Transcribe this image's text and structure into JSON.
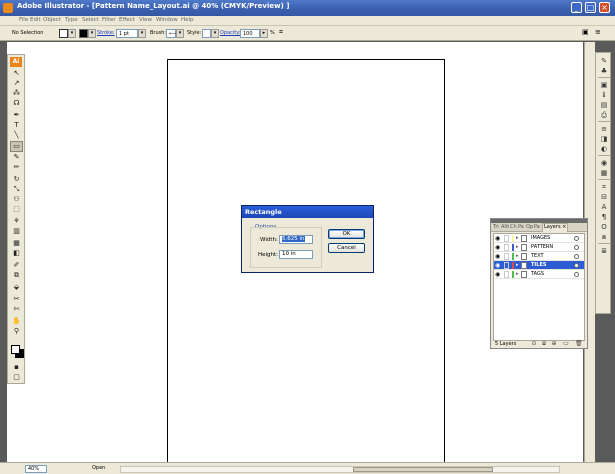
{
  "window": {
    "title": "Adobe Illustrator - [Pattern Name_Layout.ai @ 40% (CMYK/Preview) ]",
    "minimize": "_",
    "maximize": "□",
    "close": "×"
  },
  "menu": [
    "File",
    "Edit",
    "Object",
    "Type",
    "Select",
    "Filter",
    "Effect",
    "View",
    "Window",
    "Help"
  ],
  "control_bar": {
    "selection": "No Selection",
    "stroke_label": "Stroke:",
    "stroke_value": "1 pt",
    "brush_label": "Brush:",
    "style_label": "Style:",
    "opacity_label": "Opacity:",
    "opacity_value": "100",
    "percent": "%"
  },
  "toolbox": {
    "logo": "Ai",
    "tools": [
      {
        "name": "selection-tool-icon",
        "glyph": "↖"
      },
      {
        "name": "direct-selection-tool-icon",
        "glyph": "↗"
      },
      {
        "name": "magic-wand-tool-icon",
        "glyph": "⁂"
      },
      {
        "name": "lasso-tool-icon",
        "glyph": "☊"
      },
      {
        "name": "pen-tool-icon",
        "glyph": "✒"
      },
      {
        "name": "type-tool-icon",
        "glyph": "T"
      },
      {
        "name": "line-tool-icon",
        "glyph": "╲"
      },
      {
        "name": "rectangle-tool-icon",
        "glyph": "▭"
      },
      {
        "name": "paintbrush-tool-icon",
        "glyph": "✎"
      },
      {
        "name": "pencil-tool-icon",
        "glyph": "✏"
      },
      {
        "name": "rotate-tool-icon",
        "glyph": "↻"
      },
      {
        "name": "scale-tool-icon",
        "glyph": "⤡"
      },
      {
        "name": "warp-tool-icon",
        "glyph": "⚇"
      },
      {
        "name": "free-transform-tool-icon",
        "glyph": "⬚"
      },
      {
        "name": "symbol-sprayer-tool-icon",
        "glyph": "⚘"
      },
      {
        "name": "graph-tool-icon",
        "glyph": "▥"
      },
      {
        "name": "mesh-tool-icon",
        "glyph": "▦"
      },
      {
        "name": "gradient-tool-icon",
        "glyph": "◧"
      },
      {
        "name": "eyedropper-tool-icon",
        "glyph": "✐"
      },
      {
        "name": "blend-tool-icon",
        "glyph": "⧉"
      },
      {
        "name": "live-paint-tool-icon",
        "glyph": "⬙"
      },
      {
        "name": "slice-tool-icon",
        "glyph": "✂"
      },
      {
        "name": "scissors-tool-icon",
        "glyph": "✄"
      },
      {
        "name": "hand-tool-icon",
        "glyph": "✋"
      },
      {
        "name": "zoom-tool-icon",
        "glyph": "⚲"
      }
    ]
  },
  "dialog": {
    "title": "Rectangle",
    "group_label": "Options",
    "width_label": "Width:",
    "width_value": "5.625 in",
    "height_label": "Height:",
    "height_value": "10 in",
    "ok_label": "OK",
    "cancel_label": "Cancel"
  },
  "layers_panel": {
    "tabs": [
      "Tri",
      "Alit",
      "Ch",
      "Pa",
      "Op",
      "Pa",
      "Layers"
    ],
    "close": "×",
    "layers": [
      {
        "name": "IMAGES",
        "color": "#f7f7a0",
        "selected": false
      },
      {
        "name": "PATTERN",
        "color": "#3c5ad8",
        "selected": false
      },
      {
        "name": "TEXT",
        "color": "#4cc04c",
        "selected": false
      },
      {
        "name": "TILES",
        "color": "#e24a4a",
        "selected": true
      },
      {
        "name": "TAGS",
        "color": "#4cc04c",
        "selected": false
      }
    ],
    "count": "5 Layers"
  },
  "status_bar": {
    "zoom": "40%",
    "status": "Open"
  },
  "colors": {
    "title_bar": "#3a5fae",
    "chrome": "#ece9d8",
    "selection_highlight": "#2e5cd4",
    "ai_logo": "#e8861c"
  }
}
